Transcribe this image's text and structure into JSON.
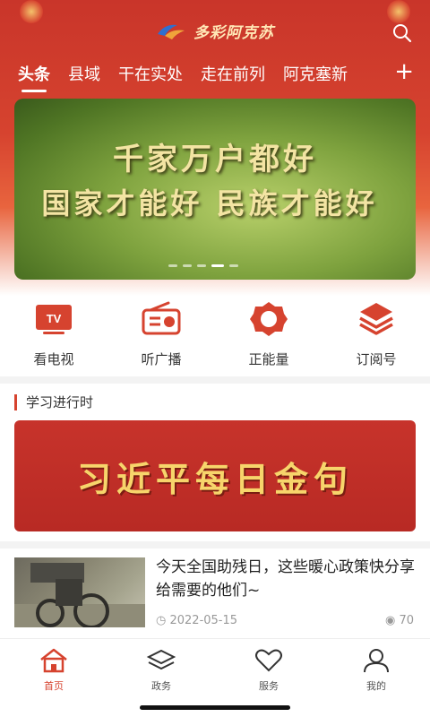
{
  "header": {
    "logo_text": "多彩阿克苏",
    "tabs": [
      "头条",
      "县域",
      "干在实处",
      "走在前列",
      "阿克塞新"
    ],
    "active_tab": 0,
    "plus_label": "+"
  },
  "banner": {
    "line1": "千家万户都好",
    "line2": "国家才能好 民族才能好",
    "page_count": 5,
    "active_page": 3
  },
  "quick_links": [
    {
      "label": "看电视",
      "icon": "tv-icon"
    },
    {
      "label": "听广播",
      "icon": "radio-icon"
    },
    {
      "label": "正能量",
      "icon": "flower-icon"
    },
    {
      "label": "订阅号",
      "icon": "layers-icon"
    }
  ],
  "section": {
    "title": "学习进行时"
  },
  "study_card": {
    "text": "习近平每日金句"
  },
  "news": [
    {
      "title": "今天全国助残日，这些暖心政策快分享给需要的他们~",
      "date": "2022-05-15",
      "views": "70"
    }
  ],
  "bottom_nav": [
    {
      "label": "首页",
      "icon": "home-icon"
    },
    {
      "label": "政务",
      "icon": "gov-icon"
    },
    {
      "label": "服务",
      "icon": "heart-icon"
    },
    {
      "label": "我的",
      "icon": "user-icon"
    }
  ],
  "active_nav": 0,
  "colors": {
    "brand_red": "#d6432f",
    "gold": "#f7d56b"
  }
}
